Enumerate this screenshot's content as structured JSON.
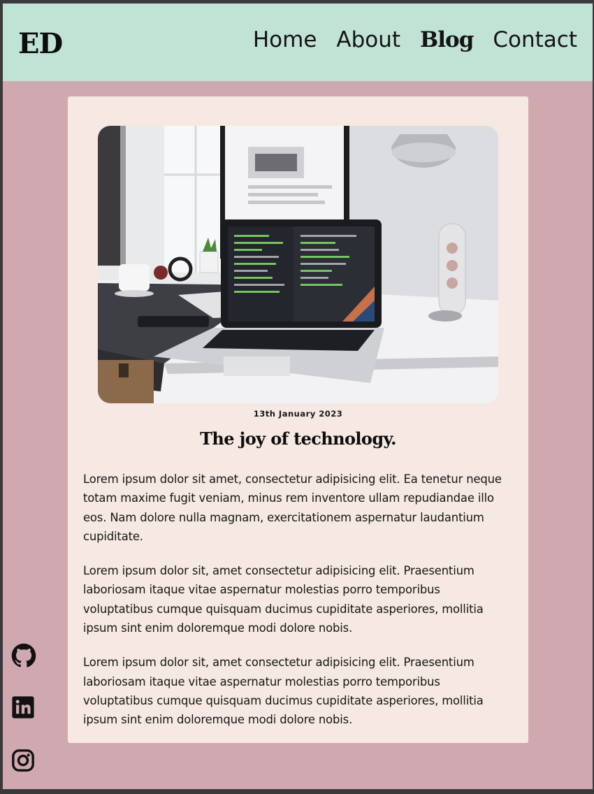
{
  "header": {
    "logo": "ED",
    "nav": [
      {
        "label": "Home",
        "active": false
      },
      {
        "label": "About",
        "active": false
      },
      {
        "label": "Blog",
        "active": true
      },
      {
        "label": "Contact",
        "active": false
      }
    ]
  },
  "post": {
    "date": "13th January 2023",
    "title": "The joy of technology.",
    "paragraphs": [
      "Lorem ipsum dolor sit amet, consectetur adipisicing elit. Ea tenetur neque totam maxime fugit veniam, minus rem inventore ullam repudiandae illo eos. Nam dolore nulla magnam, exercitationem aspernatur laudantium cupiditate.",
      "Lorem ipsum dolor sit, amet consectetur adipisicing elit. Praesentium laboriosam itaque vitae aspernatur molestias porro temporibus voluptatibus cumque quisquam ducimus cupiditate asperiores, mollitia ipsum sint enim doloremque modi dolore nobis.",
      "Lorem ipsum dolor sit, amet consectetur adipisicing elit. Praesentium laboriosam itaque vitae aspernatur molestias porro temporibus voluptatibus cumque quisquam ducimus cupiditate asperiores, mollitia ipsum sint enim doloremque modi dolore nobis."
    ]
  },
  "social": [
    "github-icon",
    "linkedin-icon",
    "instagram-icon"
  ],
  "colors": {
    "header_bg": "#c1e3d6",
    "page_bg": "#d0a9b0",
    "card_bg": "#f6e8e2",
    "text": "#141414"
  }
}
